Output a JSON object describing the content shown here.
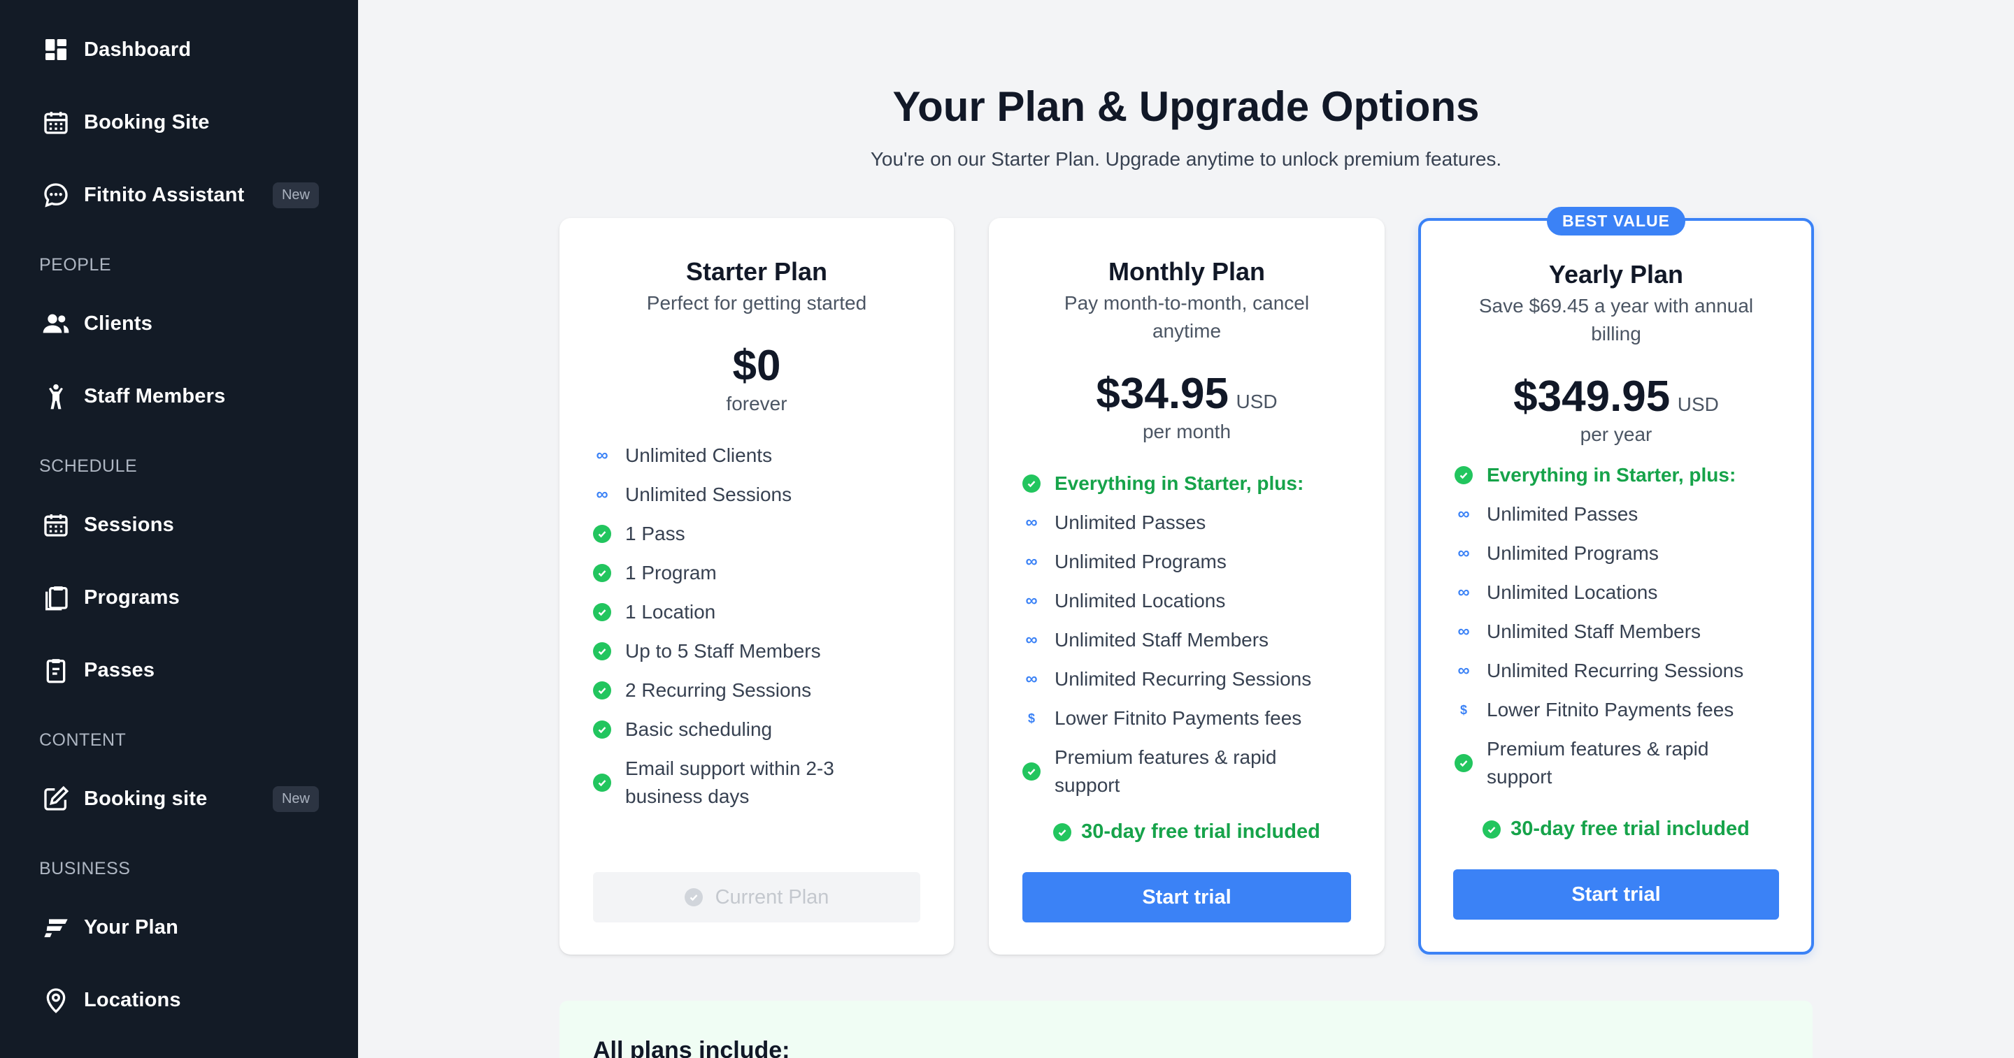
{
  "sidebar": {
    "items": [
      {
        "id": "dashboard",
        "label": "Dashboard",
        "icon": "dashboard-icon"
      },
      {
        "id": "booking-site",
        "label": "Booking Site",
        "icon": "calendar-icon"
      },
      {
        "id": "fitnito-assistant",
        "label": "Fitnito Assistant",
        "icon": "chat-bubble-icon",
        "badge": "New"
      },
      {
        "id": "clients",
        "label": "Clients",
        "icon": "users-icon"
      },
      {
        "id": "staff-members",
        "label": "Staff Members",
        "icon": "person-icon"
      },
      {
        "id": "sessions",
        "label": "Sessions",
        "icon": "calendar-icon"
      },
      {
        "id": "programs",
        "label": "Programs",
        "icon": "clipboard-stack-icon"
      },
      {
        "id": "passes",
        "label": "Passes",
        "icon": "clipboard-icon"
      },
      {
        "id": "booking-site-content",
        "label": "Booking site",
        "icon": "edit-icon",
        "badge": "New"
      },
      {
        "id": "your-plan",
        "label": "Your Plan",
        "icon": "fitnito-logo-icon"
      },
      {
        "id": "locations",
        "label": "Locations",
        "icon": "map-pin-icon"
      }
    ],
    "sections": {
      "people": "PEOPLE",
      "schedule": "SCHEDULE",
      "content": "CONTENT",
      "business": "BUSINESS"
    }
  },
  "header": {
    "title": "Your Plan & Upgrade Options",
    "subtitle": "You're on our Starter Plan. Upgrade anytime to unlock premium features."
  },
  "plans": [
    {
      "name": "Starter Plan",
      "description": "Perfect for getting started",
      "price": "$0",
      "currency": "",
      "period": "forever",
      "features": [
        {
          "icon": "infinity-icon",
          "text": "Unlimited Clients"
        },
        {
          "icon": "infinity-icon",
          "text": "Unlimited Sessions"
        },
        {
          "icon": "check-circle-icon",
          "text": "1 Pass"
        },
        {
          "icon": "check-circle-icon",
          "text": "1 Program"
        },
        {
          "icon": "check-circle-icon",
          "text": "1 Location"
        },
        {
          "icon": "check-circle-icon",
          "text": "Up to 5 Staff Members"
        },
        {
          "icon": "check-circle-icon",
          "text": "2 Recurring Sessions"
        },
        {
          "icon": "check-circle-icon",
          "text": "Basic scheduling"
        },
        {
          "icon": "check-circle-icon",
          "text": "Email support within 2-3 business days"
        }
      ],
      "button": "Current Plan"
    },
    {
      "name": "Monthly Plan",
      "description": "Pay month-to-month, cancel anytime",
      "price": "$34.95",
      "currency": "USD",
      "period": "per month",
      "features": [
        {
          "icon": "check-circle-icon",
          "text": "Everything in Starter, plus:"
        },
        {
          "icon": "infinity-icon",
          "text": "Unlimited Passes"
        },
        {
          "icon": "infinity-icon",
          "text": "Unlimited Programs"
        },
        {
          "icon": "infinity-icon",
          "text": "Unlimited Locations"
        },
        {
          "icon": "infinity-icon",
          "text": "Unlimited Staff Members"
        },
        {
          "icon": "infinity-icon",
          "text": "Unlimited Recurring Sessions"
        },
        {
          "icon": "dollar-icon",
          "text": "Lower Fitnito Payments fees"
        },
        {
          "icon": "check-circle-icon",
          "text": "Premium features & rapid support"
        }
      ],
      "trial_note": "30-day free trial included",
      "button": "Start trial"
    },
    {
      "badge": "BEST VALUE",
      "name": "Yearly Plan",
      "description": "Save $69.45 a year with annual billing",
      "price": "$349.95",
      "currency": "USD",
      "period": "per year",
      "features": [
        {
          "icon": "check-circle-icon",
          "text": "Everything in Starter, plus:"
        },
        {
          "icon": "infinity-icon",
          "text": "Unlimited Passes"
        },
        {
          "icon": "infinity-icon",
          "text": "Unlimited Programs"
        },
        {
          "icon": "infinity-icon",
          "text": "Unlimited Locations"
        },
        {
          "icon": "infinity-icon",
          "text": "Unlimited Staff Members"
        },
        {
          "icon": "infinity-icon",
          "text": "Unlimited Recurring Sessions"
        },
        {
          "icon": "dollar-icon",
          "text": "Lower Fitnito Payments fees"
        },
        {
          "icon": "check-circle-icon",
          "text": "Premium features & rapid support"
        }
      ],
      "trial_note": "30-day free trial included",
      "button": "Start trial"
    }
  ],
  "includes": {
    "title": "All plans include:"
  },
  "colors": {
    "sidebar_bg": "#131b26",
    "accent": "#3b82f6",
    "success": "#22c55e"
  }
}
